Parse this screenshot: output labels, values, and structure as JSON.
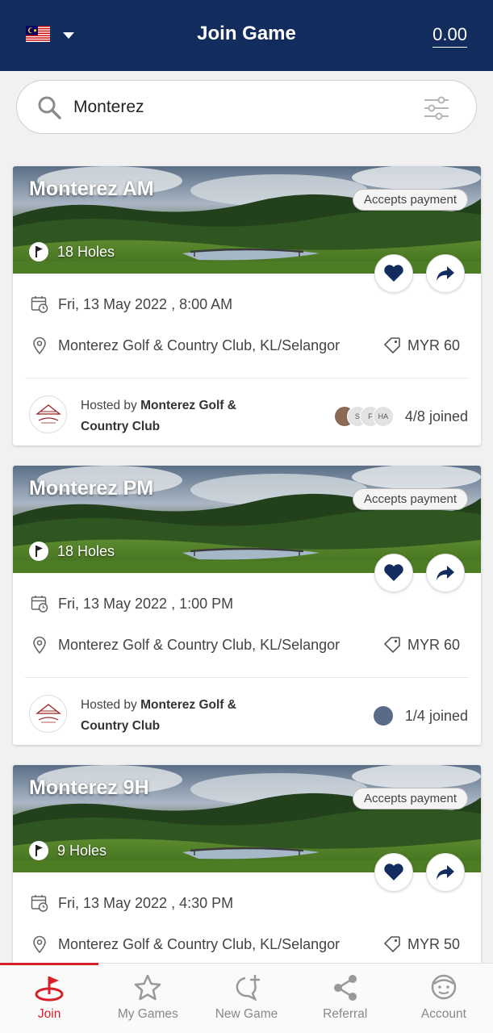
{
  "header": {
    "title": "Join Game",
    "balance": "0.00",
    "flag_icon": "malaysia-flag-icon"
  },
  "search": {
    "value": "Monterez",
    "placeholder": "Search"
  },
  "games": [
    {
      "title": "Monterez AM",
      "payment_badge": "Accepts payment",
      "holes": "18 Holes",
      "datetime": "Fri, 13 May 2022 , 8:00 AM",
      "location": "Monterez Golf & Country Club, KL/Selangor",
      "price": "MYR 60",
      "host_prefix": "Hosted by ",
      "host_name": "Monterez Golf & Country Club",
      "joined": "4/8 joined",
      "avatars": [
        "",
        "S",
        "F",
        "HA"
      ]
    },
    {
      "title": "Monterez PM",
      "payment_badge": "Accepts payment",
      "holes": "18 Holes",
      "datetime": "Fri, 13 May 2022 , 1:00 PM",
      "location": "Monterez Golf & Country Club, KL/Selangor",
      "price": "MYR 60",
      "host_prefix": "Hosted by ",
      "host_name": "Monterez Golf & Country Club",
      "joined": "1/4 joined",
      "avatars": [
        ""
      ]
    },
    {
      "title": "Monterez 9H",
      "payment_badge": "Accepts payment",
      "holes": "9 Holes",
      "datetime": "Fri, 13 May 2022 , 4:30 PM",
      "location": "Monterez Golf & Country Club, KL/Selangor",
      "price": "MYR 50"
    }
  ],
  "nav": {
    "items": [
      {
        "label": "Join",
        "icon": "golf-flag-icon",
        "active": true
      },
      {
        "label": "My Games",
        "icon": "star-icon",
        "active": false
      },
      {
        "label": "New Game",
        "icon": "chat-plus-icon",
        "active": false
      },
      {
        "label": "Referral",
        "icon": "share-icon",
        "active": false
      },
      {
        "label": "Account",
        "icon": "user-icon",
        "active": false
      }
    ]
  },
  "colors": {
    "header_bg": "#132c5e",
    "accent_red": "#d91f26",
    "heart": "#132c5e"
  }
}
